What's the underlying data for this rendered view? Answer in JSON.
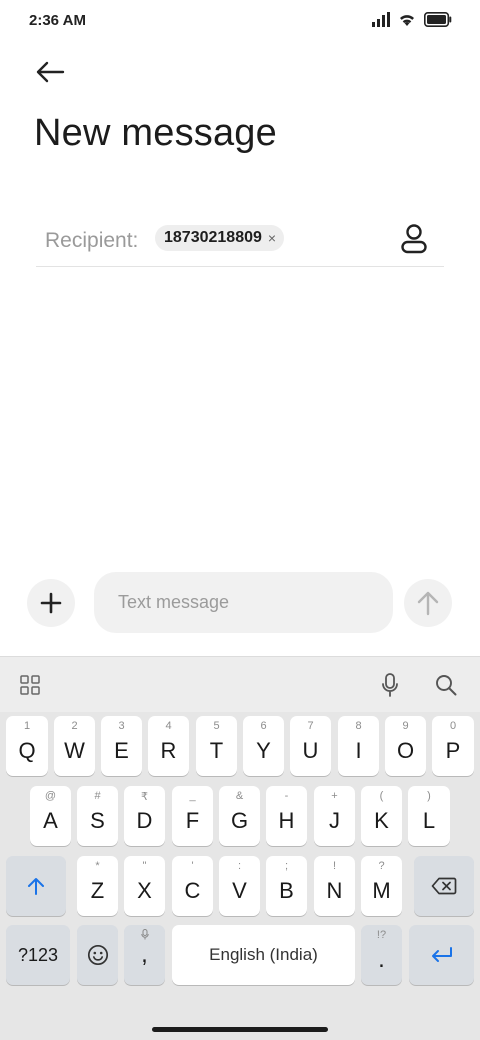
{
  "status_bar": {
    "time": "2:36 AM"
  },
  "header": {
    "title": "New message"
  },
  "recipient": {
    "label": "Recipient:",
    "chip_number": "18730218809",
    "chip_remove": "×"
  },
  "compose": {
    "placeholder": "Text message"
  },
  "keyboard": {
    "row1": [
      {
        "hint": "1",
        "label": "Q"
      },
      {
        "hint": "2",
        "label": "W"
      },
      {
        "hint": "3",
        "label": "E"
      },
      {
        "hint": "4",
        "label": "R"
      },
      {
        "hint": "5",
        "label": "T"
      },
      {
        "hint": "6",
        "label": "Y"
      },
      {
        "hint": "7",
        "label": "U"
      },
      {
        "hint": "8",
        "label": "I"
      },
      {
        "hint": "9",
        "label": "O"
      },
      {
        "hint": "0",
        "label": "P"
      }
    ],
    "row2": [
      {
        "hint": "@",
        "label": "A"
      },
      {
        "hint": "#",
        "label": "S"
      },
      {
        "hint": "₹",
        "label": "D"
      },
      {
        "hint": "_",
        "label": "F"
      },
      {
        "hint": "&",
        "label": "G"
      },
      {
        "hint": "-",
        "label": "H"
      },
      {
        "hint": "+",
        "label": "J"
      },
      {
        "hint": "(",
        "label": "K"
      },
      {
        "hint": ")",
        "label": "L"
      }
    ],
    "row3": [
      {
        "hint": "*",
        "label": "Z"
      },
      {
        "hint": "\"",
        "label": "X"
      },
      {
        "hint": "'",
        "label": "C"
      },
      {
        "hint": ":",
        "label": "V"
      },
      {
        "hint": ";",
        "label": "B"
      },
      {
        "hint": "!",
        "label": "N"
      },
      {
        "hint": "?",
        "label": "M"
      }
    ],
    "symbols_label": "?123",
    "comma_label": ",",
    "space_label": "English (India)",
    "period_hint": "!?",
    "period_label": ".",
    "accent_color": "#1a73e8"
  }
}
